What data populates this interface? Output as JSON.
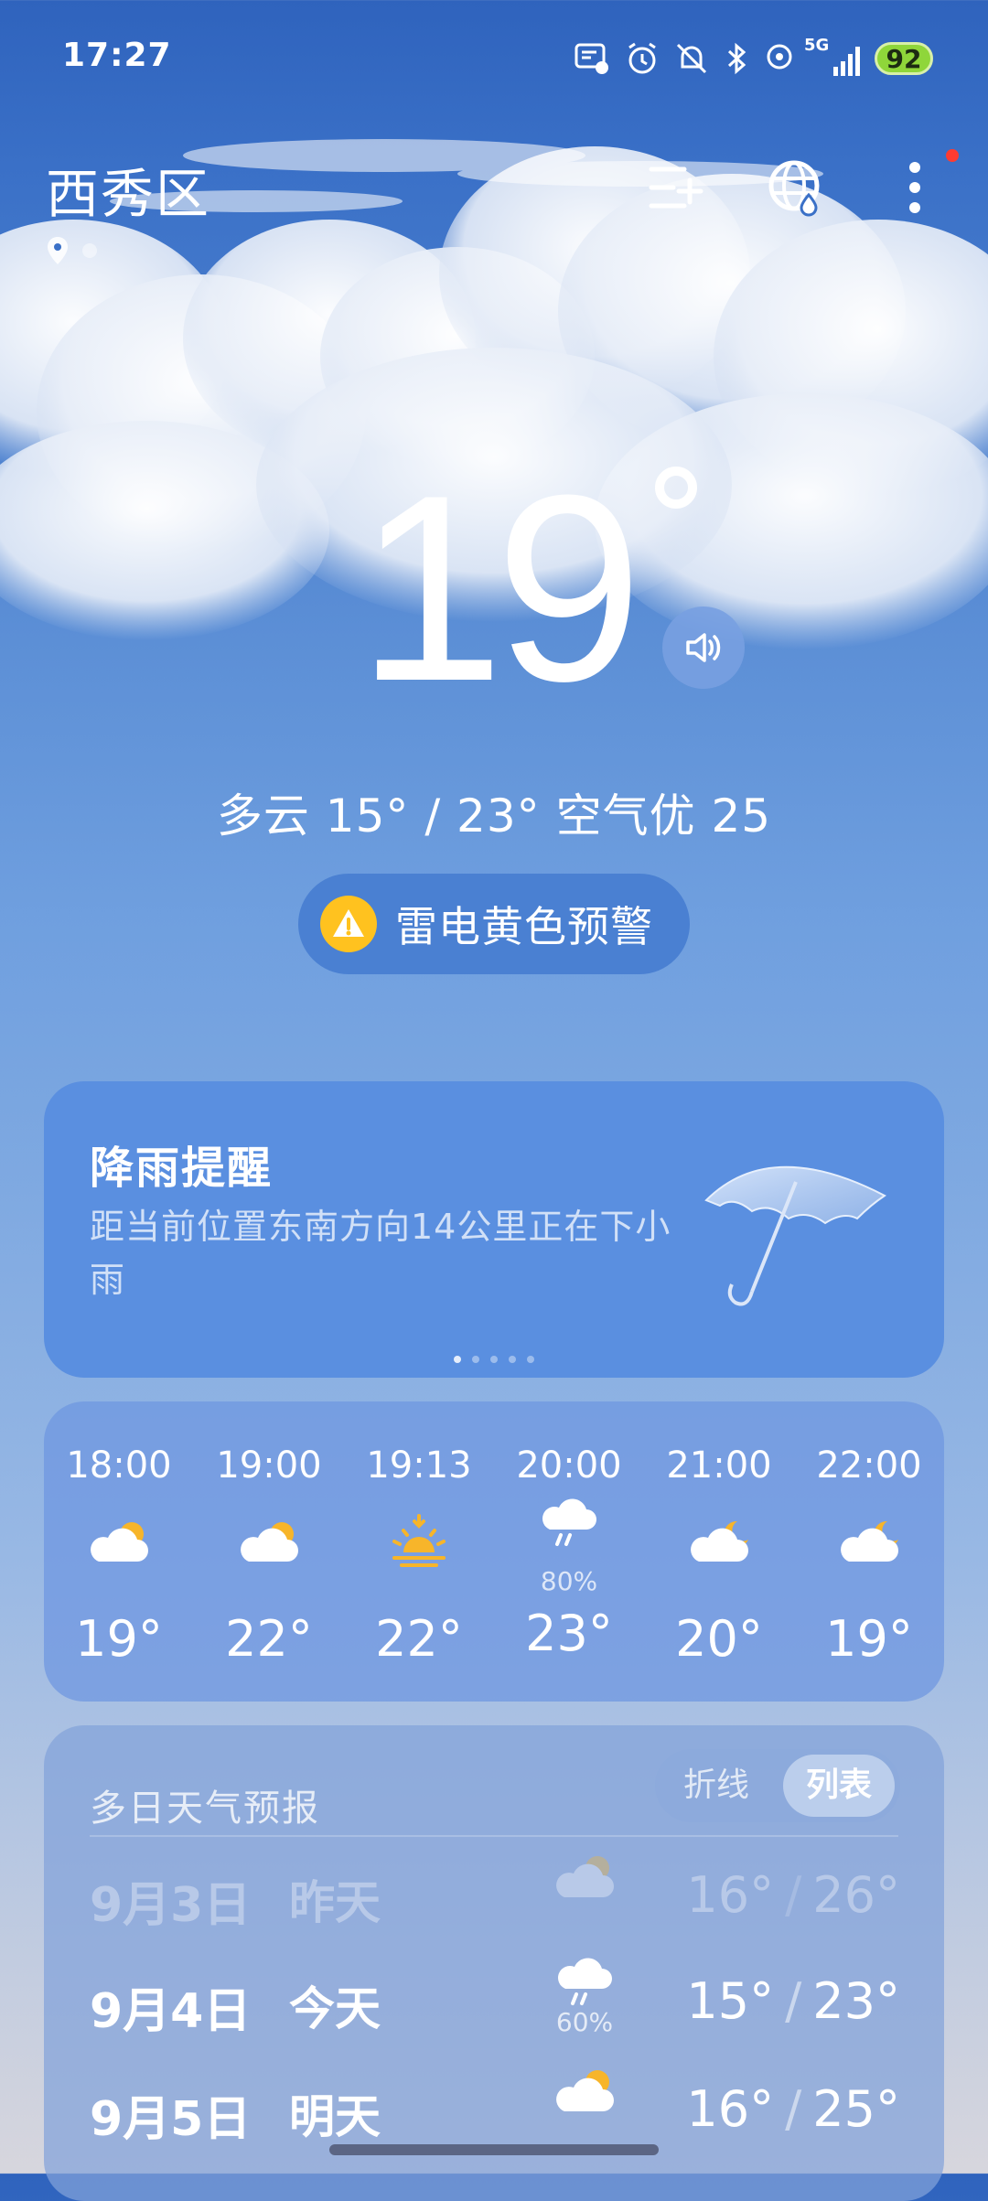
{
  "status_bar": {
    "time": "17:27",
    "network": "5G",
    "battery": "92"
  },
  "header": {
    "location": "西秀区"
  },
  "current": {
    "temperature": "19",
    "summary": "多云  15° / 23°  空气优 25",
    "alert": "雷电黄色预警"
  },
  "rain_card": {
    "title": "降雨提醒",
    "description": "距当前位置东南方向14公里正在下小雨"
  },
  "hourly": [
    {
      "time": "18:00",
      "icon": "partly-cloudy-sun-icon",
      "pop": "",
      "temp": "19°"
    },
    {
      "time": "19:00",
      "icon": "partly-cloudy-sun-icon",
      "pop": "",
      "temp": "22°"
    },
    {
      "time": "19:13",
      "icon": "sunset-icon",
      "pop": "",
      "temp": "22°"
    },
    {
      "time": "20:00",
      "icon": "rain-icon",
      "pop": "80%",
      "temp": "23°"
    },
    {
      "time": "21:00",
      "icon": "partly-cloudy-moon-icon",
      "pop": "",
      "temp": "20°"
    },
    {
      "time": "22:00",
      "icon": "partly-cloudy-moon-icon",
      "pop": "",
      "temp": "19°"
    }
  ],
  "daily": {
    "title": "多日天气预报",
    "toggle": {
      "chart": "折线",
      "list": "列表",
      "selected": "列表"
    },
    "days": [
      {
        "date": "9月3日",
        "label": "昨天",
        "icon": "partly-cloudy-sun-icon",
        "pop": "",
        "low": "16°",
        "high": "26°"
      },
      {
        "date": "9月4日",
        "label": "今天",
        "icon": "rain-icon",
        "pop": "60%",
        "low": "15°",
        "high": "23°"
      },
      {
        "date": "9月5日",
        "label": "明天",
        "icon": "partly-cloudy-sun-icon",
        "pop": "",
        "low": "16°",
        "high": "25°"
      }
    ]
  }
}
